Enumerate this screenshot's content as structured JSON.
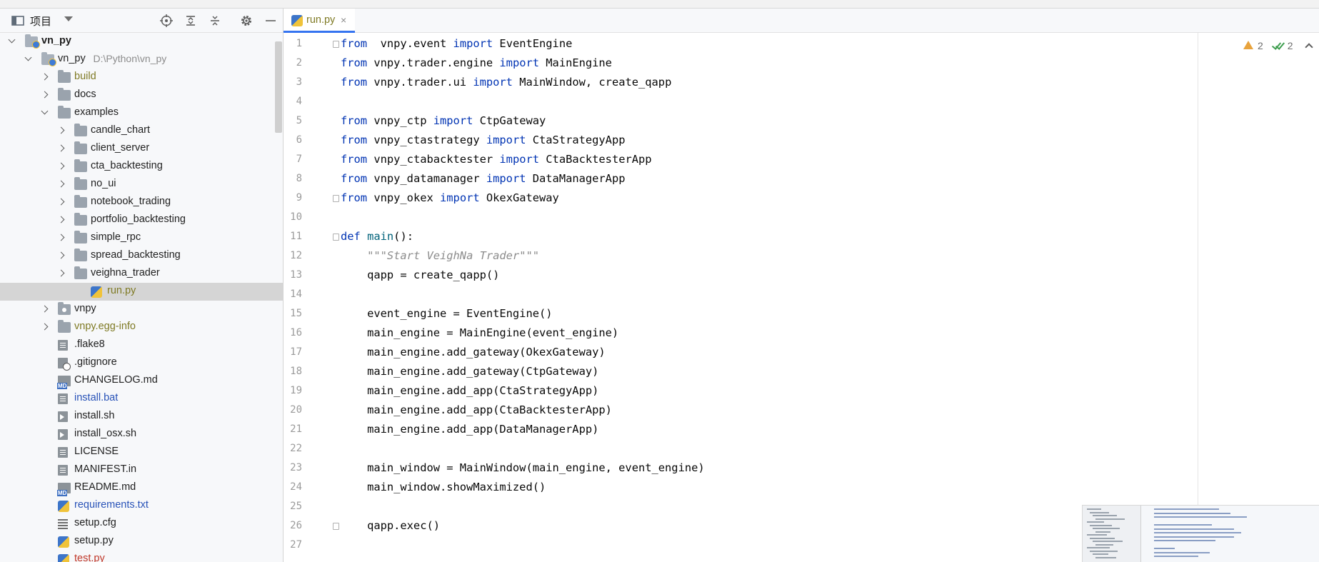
{
  "project_panel": {
    "title": "项目",
    "tree": [
      {
        "label": "vn_py",
        "hint": "",
        "depth": 0,
        "expand": "down",
        "icon": "root-folder",
        "style": "bold"
      },
      {
        "label": "vn_py",
        "hint": "D:\\Python\\vn_py",
        "depth": 1,
        "expand": "down",
        "icon": "root-folder",
        "style": ""
      },
      {
        "label": "build",
        "hint": "",
        "depth": 2,
        "expand": "right",
        "icon": "folder",
        "style": "olive"
      },
      {
        "label": "docs",
        "hint": "",
        "depth": 2,
        "expand": "right",
        "icon": "folder",
        "style": ""
      },
      {
        "label": "examples",
        "hint": "",
        "depth": 2,
        "expand": "down",
        "icon": "folder",
        "style": ""
      },
      {
        "label": "candle_chart",
        "hint": "",
        "depth": 3,
        "expand": "right",
        "icon": "folder",
        "style": ""
      },
      {
        "label": "client_server",
        "hint": "",
        "depth": 3,
        "expand": "right",
        "icon": "folder",
        "style": ""
      },
      {
        "label": "cta_backtesting",
        "hint": "",
        "depth": 3,
        "expand": "right",
        "icon": "folder",
        "style": ""
      },
      {
        "label": "no_ui",
        "hint": "",
        "depth": 3,
        "expand": "right",
        "icon": "folder",
        "style": ""
      },
      {
        "label": "notebook_trading",
        "hint": "",
        "depth": 3,
        "expand": "right",
        "icon": "folder",
        "style": ""
      },
      {
        "label": "portfolio_backtesting",
        "hint": "",
        "depth": 3,
        "expand": "right",
        "icon": "folder",
        "style": ""
      },
      {
        "label": "simple_rpc",
        "hint": "",
        "depth": 3,
        "expand": "right",
        "icon": "folder",
        "style": ""
      },
      {
        "label": "spread_backtesting",
        "hint": "",
        "depth": 3,
        "expand": "right",
        "icon": "folder",
        "style": ""
      },
      {
        "label": "veighna_trader",
        "hint": "",
        "depth": 3,
        "expand": "right",
        "icon": "folder",
        "style": ""
      },
      {
        "label": "run.py",
        "hint": "",
        "depth": 4,
        "expand": "",
        "icon": "py",
        "style": "olive",
        "selected": true
      },
      {
        "label": "vnpy",
        "hint": "",
        "depth": 2,
        "expand": "right",
        "icon": "pkg-folder",
        "style": ""
      },
      {
        "label": "vnpy.egg-info",
        "hint": "",
        "depth": 2,
        "expand": "right",
        "icon": "folder",
        "style": "olive"
      },
      {
        "label": ".flake8",
        "hint": "",
        "depth": 2,
        "expand": "",
        "icon": "file",
        "style": ""
      },
      {
        "label": ".gitignore",
        "hint": "",
        "depth": 2,
        "expand": "",
        "icon": "ignore",
        "style": ""
      },
      {
        "label": "CHANGELOG.md",
        "hint": "",
        "depth": 2,
        "expand": "",
        "icon": "md",
        "style": ""
      },
      {
        "label": "install.bat",
        "hint": "",
        "depth": 2,
        "expand": "",
        "icon": "file",
        "style": "blue"
      },
      {
        "label": "install.sh",
        "hint": "",
        "depth": 2,
        "expand": "",
        "icon": "sh",
        "style": ""
      },
      {
        "label": "install_osx.sh",
        "hint": "",
        "depth": 2,
        "expand": "",
        "icon": "sh",
        "style": ""
      },
      {
        "label": "LICENSE",
        "hint": "",
        "depth": 2,
        "expand": "",
        "icon": "file",
        "style": ""
      },
      {
        "label": "MANIFEST.in",
        "hint": "",
        "depth": 2,
        "expand": "",
        "icon": "file",
        "style": ""
      },
      {
        "label": "README.md",
        "hint": "",
        "depth": 2,
        "expand": "",
        "icon": "md",
        "style": ""
      },
      {
        "label": "requirements.txt",
        "hint": "",
        "depth": 2,
        "expand": "",
        "icon": "py",
        "style": "blue"
      },
      {
        "label": "setup.cfg",
        "hint": "",
        "depth": 2,
        "expand": "",
        "icon": "cfg",
        "style": ""
      },
      {
        "label": "setup.py",
        "hint": "",
        "depth": 2,
        "expand": "",
        "icon": "py",
        "style": ""
      },
      {
        "label": "test.py",
        "hint": "",
        "depth": 2,
        "expand": "",
        "icon": "py",
        "style": "red"
      }
    ]
  },
  "editor": {
    "tab_label": "run.py",
    "tab_close": "×",
    "inspections": {
      "warnings": "2",
      "typos": "2"
    },
    "lines": [
      [
        [
          "kw",
          "from"
        ],
        [
          "",
          "  vnpy.event "
        ],
        [
          "kw",
          "import"
        ],
        [
          "",
          " EventEngine"
        ]
      ],
      [
        [
          "kw",
          "from"
        ],
        [
          "",
          " vnpy.trader.engine "
        ],
        [
          "kw",
          "import"
        ],
        [
          "",
          " MainEngine"
        ]
      ],
      [
        [
          "kw",
          "from"
        ],
        [
          "",
          " vnpy.trader.ui "
        ],
        [
          "kw",
          "import"
        ],
        [
          "",
          " MainWindow, create_qapp"
        ]
      ],
      [],
      [
        [
          "kw",
          "from"
        ],
        [
          "",
          " vnpy_ctp "
        ],
        [
          "kw",
          "import"
        ],
        [
          "",
          " CtpGateway"
        ]
      ],
      [
        [
          "kw",
          "from"
        ],
        [
          "",
          " vnpy_ctastrategy "
        ],
        [
          "kw",
          "import"
        ],
        [
          "",
          " CtaStrategyApp"
        ]
      ],
      [
        [
          "kw",
          "from"
        ],
        [
          "",
          " vnpy_ctabacktester "
        ],
        [
          "kw",
          "import"
        ],
        [
          "",
          " CtaBacktesterApp"
        ]
      ],
      [
        [
          "kw",
          "from"
        ],
        [
          "",
          " vnpy_datamanager "
        ],
        [
          "kw",
          "import"
        ],
        [
          "",
          " DataManagerApp"
        ]
      ],
      [
        [
          "kw",
          "from"
        ],
        [
          "",
          " vnpy_okex "
        ],
        [
          "kw",
          "import"
        ],
        [
          "",
          " OkexGateway"
        ]
      ],
      [],
      [
        [
          "kw",
          "def"
        ],
        [
          "",
          " "
        ],
        [
          "fn",
          "main"
        ],
        [
          "",
          "():"
        ]
      ],
      [
        [
          "",
          "    "
        ],
        [
          "doc",
          "\"\"\"Start VeighNa Trader\"\"\""
        ]
      ],
      [
        [
          "",
          "    qapp = create_qapp()"
        ]
      ],
      [],
      [
        [
          "",
          "    event_engine = EventEngine()"
        ]
      ],
      [
        [
          "",
          "    main_engine = MainEngine(event_engine)"
        ]
      ],
      [
        [
          "",
          "    main_engine.add_gateway(OkexGateway)"
        ]
      ],
      [
        [
          "",
          "    main_engine.add_gateway(CtpGateway)"
        ]
      ],
      [
        [
          "",
          "    main_engine.add_app(CtaStrategyApp)"
        ]
      ],
      [
        [
          "",
          "    main_engine.add_app(CtaBacktesterApp)"
        ]
      ],
      [
        [
          "",
          "    main_engine.add_app(DataManagerApp)"
        ]
      ],
      [],
      [
        [
          "",
          "    main_window = MainWindow(main_engine, event_engine)"
        ]
      ],
      [
        [
          "",
          "    main_window.showMaximized()"
        ]
      ],
      [],
      [
        [
          "",
          "    qapp.exec()"
        ]
      ],
      []
    ]
  }
}
